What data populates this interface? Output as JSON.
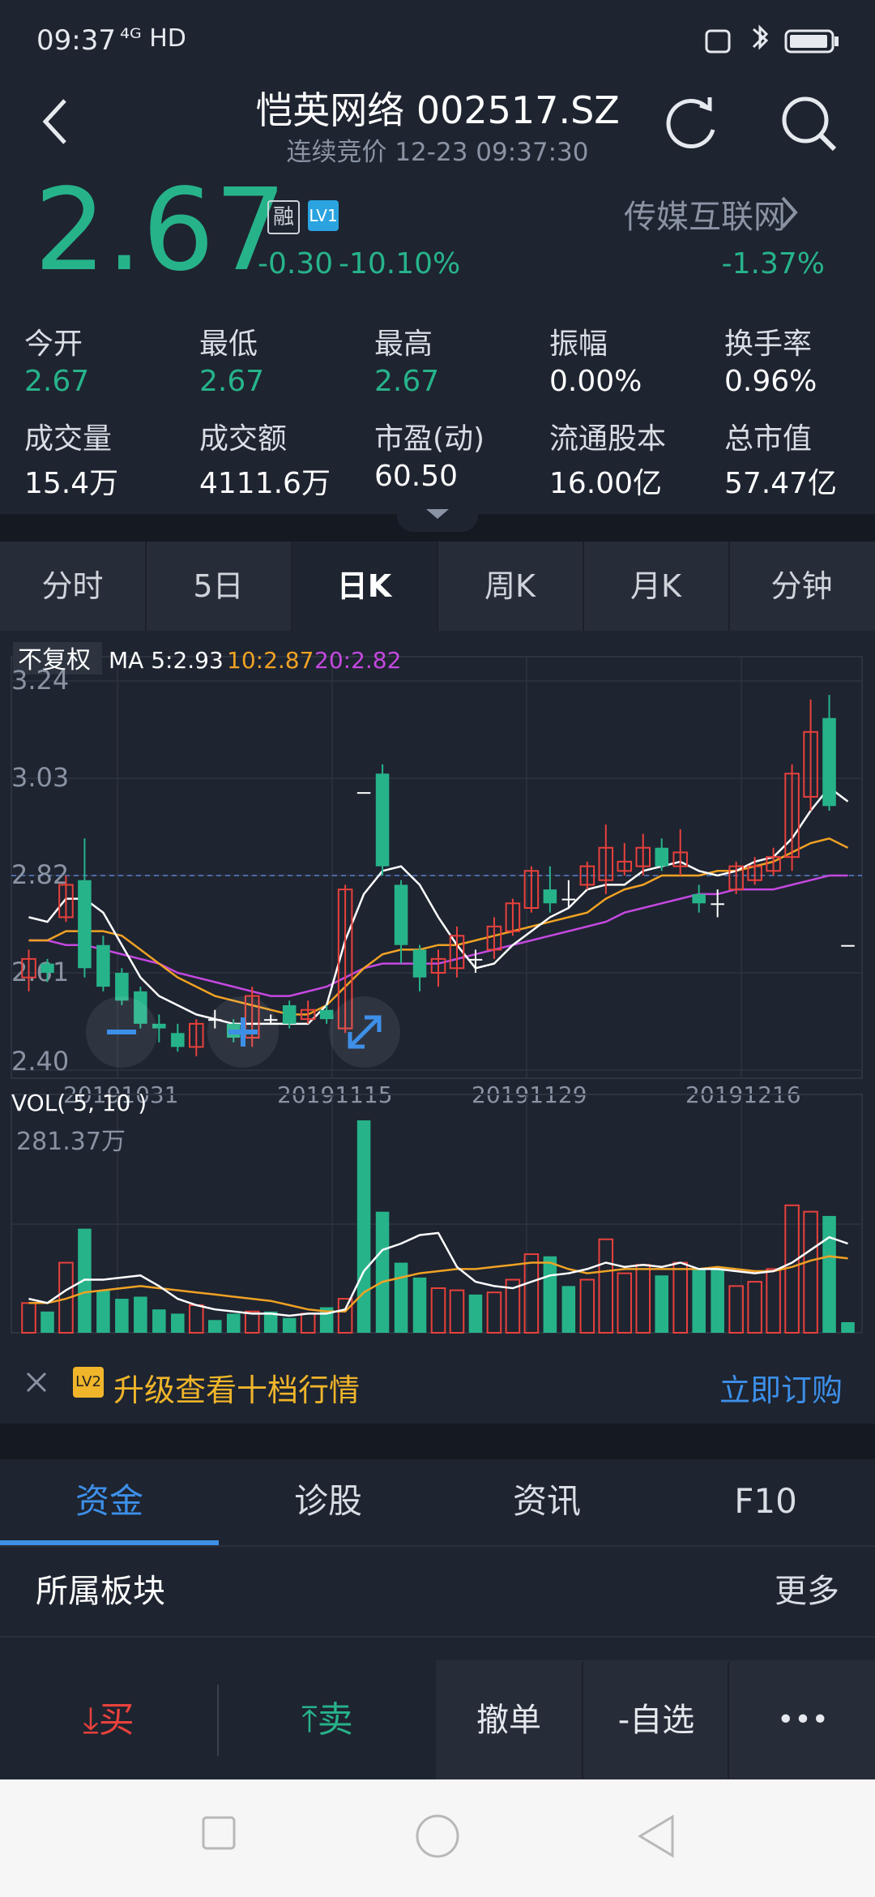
{
  "status_bar": {
    "time": "09:37",
    "network": "⁴ᴳ HD",
    "icons": "vibrate bluetooth battery"
  },
  "header": {
    "title": "恺英网络 002517.SZ",
    "subtitle": "连续竞价 12-23 09:37:30"
  },
  "quote": {
    "price": "2.67",
    "badge_rong": "融",
    "badge_lv": "LV1",
    "change": "-0.30",
    "change_pct": "-10.10%",
    "sector_name": "传媒互联网",
    "sector_pct": "-1.37%",
    "colors": {
      "down": "#27b38a",
      "up": "#e8413c"
    }
  },
  "stats": [
    {
      "label": "今开",
      "value": "2.67"
    },
    {
      "label": "最低",
      "value": "2.67"
    },
    {
      "label": "最高",
      "value": "2.67"
    },
    {
      "label": "振幅",
      "value": "0.00%"
    },
    {
      "label": "换手率",
      "value": "0.96%"
    },
    {
      "label": "成交量",
      "value": "15.4万"
    },
    {
      "label": "成交额",
      "value": "4111.6万"
    },
    {
      "label": "市盈(动)",
      "value": "60.50"
    },
    {
      "label": "流通股本",
      "value": "16.00亿"
    },
    {
      "label": "总市值",
      "value": "57.47亿"
    }
  ],
  "period_tabs": [
    "分时",
    "5日",
    "日K",
    "周K",
    "月K",
    "分钟"
  ],
  "active_period": 2,
  "chart": {
    "fq_label": "不复权",
    "ma_label": "MA 5:2.93",
    "ma10_label": "10:2.87",
    "ma20_label": "20:2.82",
    "y_ticks": [
      "3.24",
      "3.03",
      "2.82",
      "2.61",
      "2.40"
    ],
    "x_ticks": [
      "20191031",
      "20191115",
      "20191129",
      "20191216"
    ],
    "vol_label": "VOL( 5, 10 )",
    "vol_max": "281.37万"
  },
  "chart_data": {
    "type": "candlestick",
    "ylim": [
      2.4,
      3.24
    ],
    "reference_price": 2.82,
    "candles": [
      {
        "o": 2.6,
        "c": 2.64,
        "h": 2.66,
        "l": 2.57
      },
      {
        "o": 2.63,
        "c": 2.61,
        "h": 2.64,
        "l": 2.59
      },
      {
        "o": 2.73,
        "c": 2.8,
        "h": 2.82,
        "l": 2.72
      },
      {
        "o": 2.81,
        "c": 2.62,
        "h": 2.9,
        "l": 2.6
      },
      {
        "o": 2.67,
        "c": 2.58,
        "h": 2.69,
        "l": 2.57
      },
      {
        "o": 2.61,
        "c": 2.55,
        "h": 2.62,
        "l": 2.54
      },
      {
        "o": 2.57,
        "c": 2.5,
        "h": 2.58,
        "l": 2.49
      },
      {
        "o": 2.5,
        "c": 2.49,
        "h": 2.52,
        "l": 2.46
      },
      {
        "o": 2.48,
        "c": 2.45,
        "h": 2.5,
        "l": 2.44
      },
      {
        "o": 2.45,
        "c": 2.5,
        "h": 2.51,
        "l": 2.43
      },
      {
        "o": 2.51,
        "c": 2.51,
        "h": 2.53,
        "l": 2.49
      },
      {
        "o": 2.5,
        "c": 2.47,
        "h": 2.51,
        "l": 2.46
      },
      {
        "o": 2.47,
        "c": 2.56,
        "h": 2.58,
        "l": 2.45
      },
      {
        "o": 2.51,
        "c": 2.51,
        "h": 2.52,
        "l": 2.5
      },
      {
        "o": 2.54,
        "c": 2.5,
        "h": 2.55,
        "l": 2.49
      },
      {
        "o": 2.51,
        "c": 2.53,
        "h": 2.55,
        "l": 2.5
      },
      {
        "o": 2.53,
        "c": 2.51,
        "h": 2.54,
        "l": 2.5
      },
      {
        "o": 2.49,
        "c": 2.79,
        "h": 2.8,
        "l": 2.48
      },
      {
        "o": 3.0,
        "c": 3.0,
        "h": 3.0,
        "l": 3.0
      },
      {
        "o": 3.04,
        "c": 2.84,
        "h": 3.06,
        "l": 2.82
      },
      {
        "o": 2.8,
        "c": 2.67,
        "h": 2.81,
        "l": 2.63
      },
      {
        "o": 2.66,
        "c": 2.6,
        "h": 2.67,
        "l": 2.57
      },
      {
        "o": 2.61,
        "c": 2.64,
        "h": 2.66,
        "l": 2.58
      },
      {
        "o": 2.62,
        "c": 2.69,
        "h": 2.71,
        "l": 2.6
      },
      {
        "o": 2.64,
        "c": 2.64,
        "h": 2.66,
        "l": 2.61
      },
      {
        "o": 2.66,
        "c": 2.71,
        "h": 2.73,
        "l": 2.64
      },
      {
        "o": 2.7,
        "c": 2.76,
        "h": 2.77,
        "l": 2.69
      },
      {
        "o": 2.75,
        "c": 2.83,
        "h": 2.84,
        "l": 2.74
      },
      {
        "o": 2.79,
        "c": 2.76,
        "h": 2.84,
        "l": 2.74
      },
      {
        "o": 2.77,
        "c": 2.77,
        "h": 2.81,
        "l": 2.75
      },
      {
        "o": 2.8,
        "c": 2.84,
        "h": 2.85,
        "l": 2.79
      },
      {
        "o": 2.81,
        "c": 2.88,
        "h": 2.93,
        "l": 2.78
      },
      {
        "o": 2.83,
        "c": 2.85,
        "h": 2.89,
        "l": 2.82
      },
      {
        "o": 2.84,
        "c": 2.88,
        "h": 2.91,
        "l": 2.82
      },
      {
        "o": 2.88,
        "c": 2.84,
        "h": 2.9,
        "l": 2.83
      },
      {
        "o": 2.84,
        "c": 2.87,
        "h": 2.92,
        "l": 2.82
      },
      {
        "o": 2.78,
        "c": 2.76,
        "h": 2.8,
        "l": 2.74
      },
      {
        "o": 2.76,
        "c": 2.76,
        "h": 2.79,
        "l": 2.73
      },
      {
        "o": 2.79,
        "c": 2.84,
        "h": 2.85,
        "l": 2.78
      },
      {
        "o": 2.81,
        "c": 2.84,
        "h": 2.86,
        "l": 2.8
      },
      {
        "o": 2.83,
        "c": 2.86,
        "h": 2.88,
        "l": 2.82
      },
      {
        "o": 2.86,
        "c": 3.04,
        "h": 3.06,
        "l": 2.83
      },
      {
        "o": 2.99,
        "c": 3.13,
        "h": 3.2,
        "l": 2.96
      },
      {
        "o": 3.16,
        "c": 2.97,
        "h": 3.21,
        "l": 2.96
      },
      {
        "o": 2.67,
        "c": 2.67,
        "h": 2.67,
        "l": 2.67
      }
    ],
    "ma5": [
      2.73,
      2.72,
      2.77,
      2.77,
      2.74,
      2.67,
      2.6,
      2.56,
      2.54,
      2.52,
      2.51,
      2.5,
      2.5,
      2.5,
      2.5,
      2.5,
      2.54,
      2.68,
      2.78,
      2.83,
      2.84,
      2.8,
      2.73,
      2.67,
      2.62,
      2.63,
      2.67,
      2.7,
      2.73,
      2.75,
      2.79,
      2.8,
      2.8,
      2.83,
      2.84,
      2.85,
      2.83,
      2.82,
      2.83,
      2.85,
      2.86,
      2.9,
      2.96,
      3.01,
      2.98
    ],
    "ma10": [
      2.68,
      2.68,
      2.7,
      2.7,
      2.7,
      2.69,
      2.66,
      2.63,
      2.6,
      2.58,
      2.56,
      2.55,
      2.54,
      2.53,
      2.52,
      2.52,
      2.54,
      2.58,
      2.62,
      2.65,
      2.66,
      2.66,
      2.67,
      2.67,
      2.68,
      2.69,
      2.7,
      2.71,
      2.72,
      2.73,
      2.74,
      2.77,
      2.79,
      2.8,
      2.82,
      2.82,
      2.82,
      2.83,
      2.83,
      2.84,
      2.85,
      2.87,
      2.89,
      2.9,
      2.88
    ],
    "ma20": [
      2.68,
      2.68,
      2.67,
      2.67,
      2.66,
      2.65,
      2.64,
      2.63,
      2.61,
      2.6,
      2.59,
      2.58,
      2.57,
      2.56,
      2.56,
      2.57,
      2.58,
      2.6,
      2.62,
      2.63,
      2.63,
      2.63,
      2.63,
      2.64,
      2.65,
      2.66,
      2.67,
      2.68,
      2.69,
      2.7,
      2.71,
      2.72,
      2.74,
      2.75,
      2.76,
      2.77,
      2.78,
      2.78,
      2.79,
      2.79,
      2.79,
      2.8,
      2.81,
      2.82,
      2.82
    ],
    "volume": [
      0.14,
      0.1,
      0.33,
      0.49,
      0.2,
      0.16,
      0.17,
      0.11,
      0.09,
      0.13,
      0.06,
      0.09,
      0.1,
      0.1,
      0.07,
      0.09,
      0.12,
      0.16,
      1.0,
      0.57,
      0.33,
      0.26,
      0.21,
      0.2,
      0.18,
      0.19,
      0.25,
      0.37,
      0.36,
      0.22,
      0.25,
      0.44,
      0.28,
      0.32,
      0.27,
      0.33,
      0.3,
      0.31,
      0.22,
      0.24,
      0.3,
      0.6,
      0.57,
      0.55,
      0.05
    ],
    "vol_ma5": [
      0.16,
      0.14,
      0.2,
      0.25,
      0.25,
      0.26,
      0.27,
      0.22,
      0.16,
      0.13,
      0.11,
      0.1,
      0.09,
      0.09,
      0.08,
      0.09,
      0.09,
      0.11,
      0.29,
      0.39,
      0.42,
      0.46,
      0.47,
      0.31,
      0.24,
      0.22,
      0.21,
      0.24,
      0.27,
      0.28,
      0.3,
      0.33,
      0.31,
      0.32,
      0.31,
      0.33,
      0.3,
      0.3,
      0.29,
      0.28,
      0.29,
      0.33,
      0.39,
      0.45,
      0.42
    ],
    "vol_ma10": [
      0.14,
      0.14,
      0.16,
      0.19,
      0.2,
      0.21,
      0.22,
      0.21,
      0.2,
      0.19,
      0.18,
      0.17,
      0.16,
      0.15,
      0.13,
      0.11,
      0.1,
      0.1,
      0.19,
      0.24,
      0.26,
      0.28,
      0.29,
      0.3,
      0.3,
      0.31,
      0.32,
      0.33,
      0.33,
      0.3,
      0.28,
      0.29,
      0.3,
      0.3,
      0.3,
      0.3,
      0.3,
      0.31,
      0.3,
      0.29,
      0.29,
      0.31,
      0.34,
      0.36,
      0.35
    ]
  },
  "banner": {
    "text": "升级查看十档行情",
    "badge": "LV2",
    "action": "立即订购"
  },
  "bottom_tabs": [
    "资金",
    "诊股",
    "资讯",
    "F10"
  ],
  "active_bottom_tab": 0,
  "section": {
    "title": "所属板块",
    "more": "更多"
  },
  "actions": {
    "buy": "买",
    "sell": "卖",
    "cancel": "撤单",
    "watch": "-自选",
    "more": "•••"
  }
}
